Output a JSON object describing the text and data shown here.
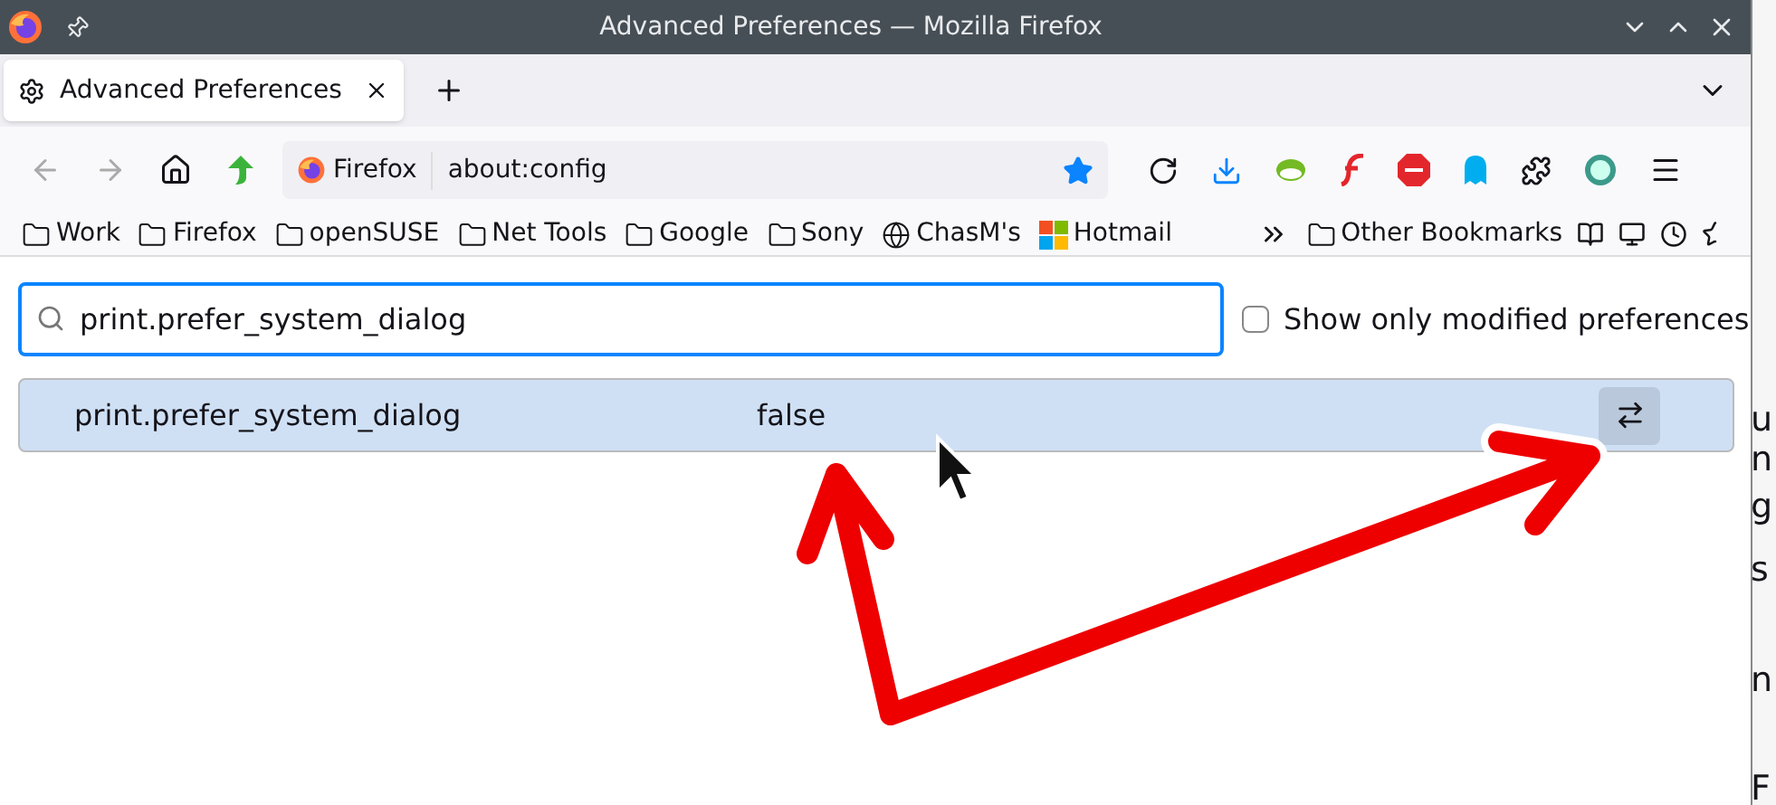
{
  "window": {
    "title": "Advanced Preferences — Mozilla Firefox"
  },
  "tabs": [
    {
      "label": "Advanced Preferences",
      "selected": true
    }
  ],
  "url_bar": {
    "identity": "Firefox",
    "url": "about:config",
    "bookmarked": true
  },
  "bookmarks": [
    {
      "label": "Work",
      "kind": "folder"
    },
    {
      "label": "Firefox",
      "kind": "folder"
    },
    {
      "label": "openSUSE",
      "kind": "folder"
    },
    {
      "label": "Net Tools",
      "kind": "folder"
    },
    {
      "label": "Google",
      "kind": "folder"
    },
    {
      "label": "Sony",
      "kind": "folder"
    },
    {
      "label": "ChasM's",
      "kind": "globe"
    },
    {
      "label": "Hotmail",
      "kind": "tiles"
    },
    {
      "label": "Other Bookmarks",
      "kind": "folder"
    }
  ],
  "search": {
    "value": "print.prefer_system_dialog"
  },
  "show_modified": {
    "label": "Show only modified preferences",
    "checked": false
  },
  "preferences": [
    {
      "name": "print.prefer_system_dialog",
      "value": "false",
      "selected": true
    }
  ],
  "background_fragments": [
    "u",
    "n",
    "g",
    "s",
    "n",
    "F"
  ]
}
